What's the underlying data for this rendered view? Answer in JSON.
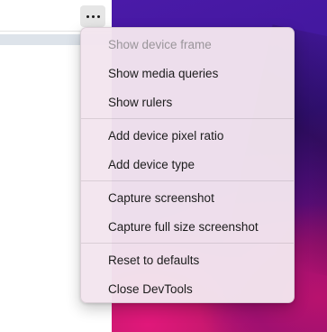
{
  "toolbar": {
    "more_icon": "more-horizontal-icon"
  },
  "menu": {
    "groups": [
      [
        {
          "label": "Show device frame",
          "enabled": false
        },
        {
          "label": "Show media queries",
          "enabled": true
        },
        {
          "label": "Show rulers",
          "enabled": true
        }
      ],
      [
        {
          "label": "Add device pixel ratio",
          "enabled": true
        },
        {
          "label": "Add device type",
          "enabled": true
        }
      ],
      [
        {
          "label": "Capture screenshot",
          "enabled": true
        },
        {
          "label": "Capture full size screenshot",
          "enabled": true
        }
      ],
      [
        {
          "label": "Reset to defaults",
          "enabled": true
        },
        {
          "label": "Close DevTools",
          "enabled": true
        }
      ]
    ]
  }
}
